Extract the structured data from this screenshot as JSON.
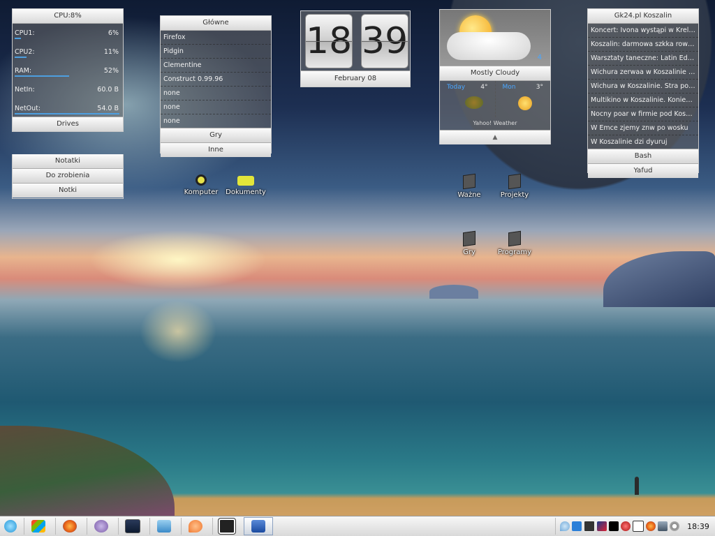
{
  "system_monitor": {
    "title": "CPU:8%",
    "rows": [
      {
        "label": "CPU1:",
        "value": "6%",
        "fill": 0.06
      },
      {
        "label": "CPU2:",
        "value": "11%",
        "fill": 0.11
      },
      {
        "label": "RAM:",
        "value": "52%",
        "fill": 0.52
      },
      {
        "label": "NetIn:",
        "value": "60.0 B",
        "fill": 0.0
      },
      {
        "label": "NetOut:",
        "value": "54.0 B",
        "fill": 1.0
      }
    ],
    "drives_label": "Drives"
  },
  "notes": {
    "items": [
      "Notatki",
      "Do zrobienia",
      "Notki"
    ]
  },
  "launcher": {
    "title": "Główne",
    "items": [
      "Firefox",
      "Pidgin",
      "Clementine",
      "Construct 0.99.96",
      "none",
      "none",
      "none"
    ],
    "buttons": [
      "Gry",
      "Inne"
    ]
  },
  "clock": {
    "hours": "18",
    "minutes": "39",
    "date": "February  08"
  },
  "weather": {
    "current_temp": "4",
    "condition": "Mostly Cloudy",
    "forecast": [
      {
        "day": "Today",
        "temp": "4°",
        "icon": "acorn-leaf-icon"
      },
      {
        "day": "Mon",
        "temp": "3°",
        "icon": "sunny-icon"
      }
    ],
    "source": "Yahoo! Weather"
  },
  "news": {
    "title": "Gk24.pl Koszalin",
    "items": [
      "Koncert: Ivona wystąpi w Krelarni",
      "Koszalin: darmowa szkka rowe...",
      "Warsztaty taneczne: Latin Editi...",
      "Wichura zerwaa w Koszalinie fr...",
      "Wichura w Koszalinie. Stra poa...",
      "Multikino w Koszalinie. Koniec...",
      "Nocny poar w firmie pod Kosz...",
      "W Emce zjemy znw po wosku",
      "W Koszalinie dzi dyuruj"
    ],
    "buttons": [
      "Bash",
      "Yafud"
    ]
  },
  "desktop_icons": [
    {
      "label": "Komputer"
    },
    {
      "label": "Dokumenty"
    },
    {
      "label": "Ważne"
    },
    {
      "label": "Projekty"
    },
    {
      "label": "Gry"
    },
    {
      "label": "Programy"
    }
  ],
  "taskbar": {
    "clock": "18:39"
  },
  "colors": {
    "accent_blue": "#4aa7ff",
    "bar_blue": "#4d9fe0"
  }
}
